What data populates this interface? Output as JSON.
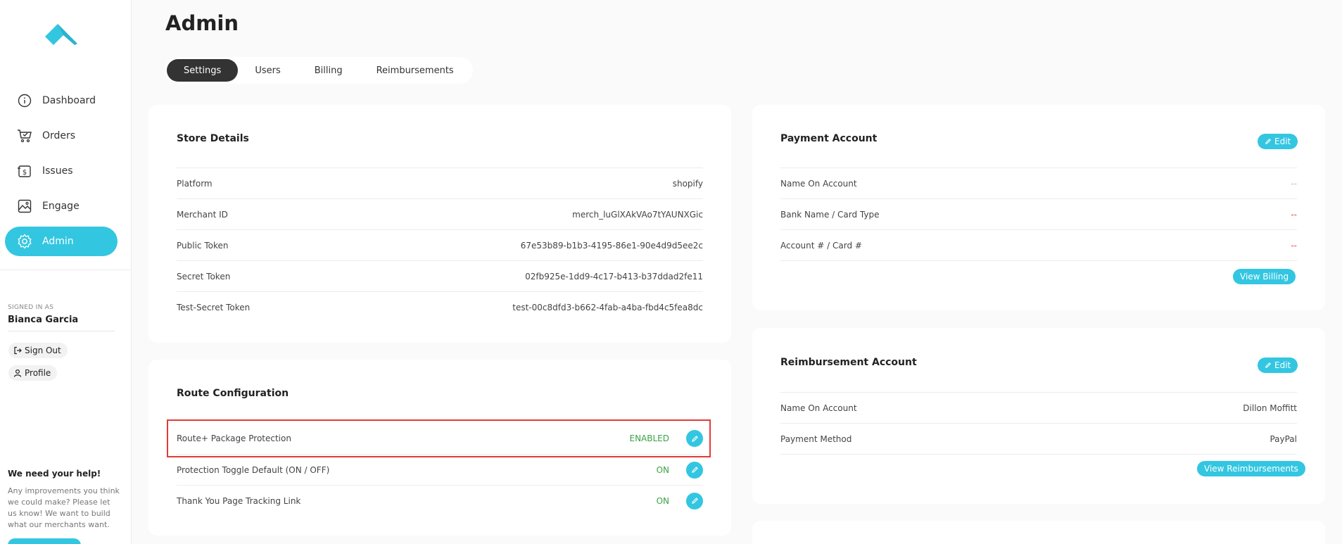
{
  "sidebar": {
    "nav": [
      {
        "label": "Dashboard",
        "icon": "info-circle-icon"
      },
      {
        "label": "Orders",
        "icon": "cart-icon"
      },
      {
        "label": "Issues",
        "icon": "dollar-doc-icon"
      },
      {
        "label": "Engage",
        "icon": "image-icon"
      },
      {
        "label": "Admin",
        "icon": "gear-icon",
        "active": true
      }
    ],
    "signed_in_label": "SIGNED IN AS",
    "user_name": "Bianca Garcia",
    "sign_out": "Sign Out",
    "profile": "Profile",
    "help_title": "We need your help!",
    "help_text": "Any improvements you think we could make? Please let us know! We want to build what our merchants want."
  },
  "page": {
    "title": "Admin",
    "tabs": [
      "Settings",
      "Users",
      "Billing",
      "Reimbursements"
    ]
  },
  "store_details": {
    "title": "Store Details",
    "rows": [
      {
        "label": "Platform",
        "value": "shopify"
      },
      {
        "label": "Merchant ID",
        "value": "merch_luGlXAkVAo7tYAUNXGic"
      },
      {
        "label": "Public Token",
        "value": "67e53b89-b1b3-4195-86e1-90e4d9d5ee2c"
      },
      {
        "label": "Secret Token",
        "value": "02fb925e-1dd9-4c17-b413-b37ddad2fe11"
      },
      {
        "label": "Test-Secret Token",
        "value": "test-00c8dfd3-b662-4fab-a4ba-fbd4c5fea8dc"
      }
    ]
  },
  "route_config": {
    "title": "Route Configuration",
    "rows": [
      {
        "label": "Route+ Package Protection",
        "value": "ENABLED"
      },
      {
        "label": "Protection Toggle Default (ON / OFF)",
        "value": "ON"
      },
      {
        "label": "Thank You Page Tracking Link",
        "value": "ON"
      }
    ]
  },
  "payment_account": {
    "title": "Payment Account",
    "edit": "Edit",
    "rows": [
      {
        "label": "Name On Account",
        "value": "--"
      },
      {
        "label": "Bank Name / Card Type",
        "value": "--"
      },
      {
        "label": "Account # / Card #",
        "value": "--"
      }
    ],
    "button": "View Billing"
  },
  "reimbursement_account": {
    "title": "Reimbursement Account",
    "edit": "Edit",
    "rows": [
      {
        "label": "Name On Account",
        "value": "Dillon Moffitt"
      },
      {
        "label": "Payment Method",
        "value": "PayPal"
      }
    ],
    "button": "View Reimbursements"
  },
  "colors": {
    "accent": "#33c6e1",
    "enabled": "#3aa344",
    "highlight": "#e53935"
  }
}
